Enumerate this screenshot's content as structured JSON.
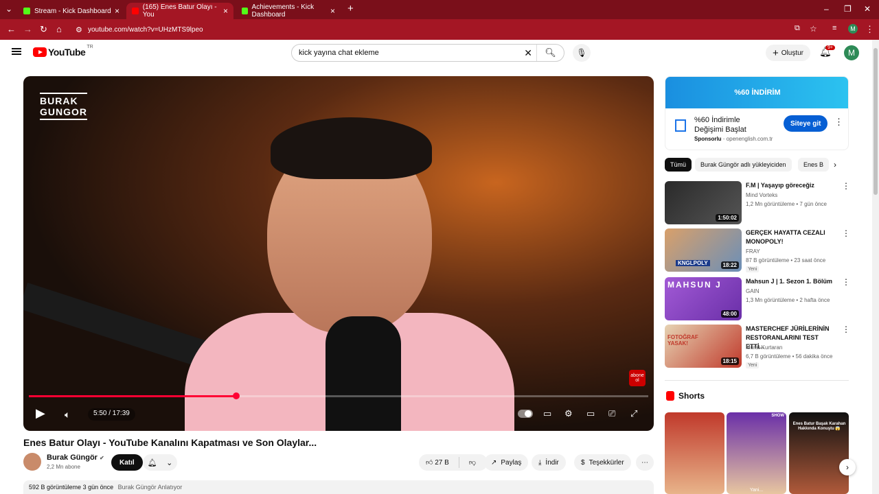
{
  "browser": {
    "tabs": [
      {
        "title": "Stream - Kick Dashboard",
        "favicon_color": "#53fc18"
      },
      {
        "title": "(165) Enes Batur Olayı - You",
        "favicon_color": "#ff0000"
      },
      {
        "title": "Achievements - Kick Dashboard",
        "favicon_color": "#53fc18"
      }
    ],
    "url": "youtube.com/watch?v=UHzMTS9lpeo",
    "profile_initial": "M",
    "accent": "#a41624"
  },
  "header": {
    "logo_text": "YouTube",
    "country": "TR",
    "search_value": "kick yayına chat ekleme",
    "create_label": "Oluştur",
    "notif_count": "9+",
    "avatar_initial": "M"
  },
  "video": {
    "overlay_logo_line1": "BURAK",
    "overlay_logo_line2": "GUNGOR",
    "progress": 0.335,
    "time": "5:50 / 17:39",
    "abone_label": "abone ol"
  },
  "below": {
    "title": "Enes Batur Olayı - YouTube Kanalını Kapatması ve Son Olaylar...",
    "channel": "Burak Güngör",
    "subscribers": "2,2 Mn abone",
    "join_label": "Katıl",
    "likes": "27 B",
    "share_label": "Paylaş",
    "download_label": "İndir",
    "thanks_label": "Teşekkürler",
    "views": "592 B görüntüleme",
    "date": "3 gün önce",
    "desc_preview": "Burak Güngör Anlatıyor"
  },
  "ad": {
    "banner_text": "%60 İNDİRİM",
    "title": "%60 İndirimle Değişimi Başlat",
    "sponsored": "Sponsorlu",
    "domain": "openenglish.com.tr",
    "cta": "Siteye git"
  },
  "chips": [
    "Tümü",
    "Burak Güngör adlı yükleyiciden",
    "Enes B"
  ],
  "recommendations": [
    {
      "title": "F.M | Yaşayıp göreceğiz",
      "channel": "Mind Vorteks",
      "meta": "1,2 Mn görüntüleme • 7 gün önce",
      "duration": "1:50:02",
      "new": ""
    },
    {
      "title": "GERÇEK HAYATTA CEZALI MONOPOLY!",
      "channel": "FRAY",
      "meta": "87 B görüntüleme • 23 saat önce",
      "duration": "18:22",
      "new": "Yeni",
      "thumb_text": "KNGLPOLY"
    },
    {
      "title": "Mahsun J | 1. Sezon 1. Bölüm",
      "channel": "GAIN",
      "meta": "1,3 Mn görüntüleme • 2 hafta önce",
      "duration": "48:00",
      "new": "",
      "thumb_text": "MAHSUN J"
    },
    {
      "title": "MASTERCHEF JÜRİLERİNİN RESTORANLARINI TEST ETTİ...",
      "channel": "Murat Kurtaran",
      "meta": "6,7 B görüntüleme • 56 dakika önce",
      "duration": "18:15",
      "new": "Yeni",
      "thumb_text": "FOTOĞRAF YASAK!"
    }
  ],
  "shorts": {
    "heading": "Shorts",
    "items": [
      {
        "caption": "",
        "footer": ""
      },
      {
        "caption": "SHOW",
        "footer": "Yani..."
      },
      {
        "caption": "Enes Batur Başak Karahan Hakkında Konuştu 😱",
        "footer": ""
      }
    ]
  }
}
